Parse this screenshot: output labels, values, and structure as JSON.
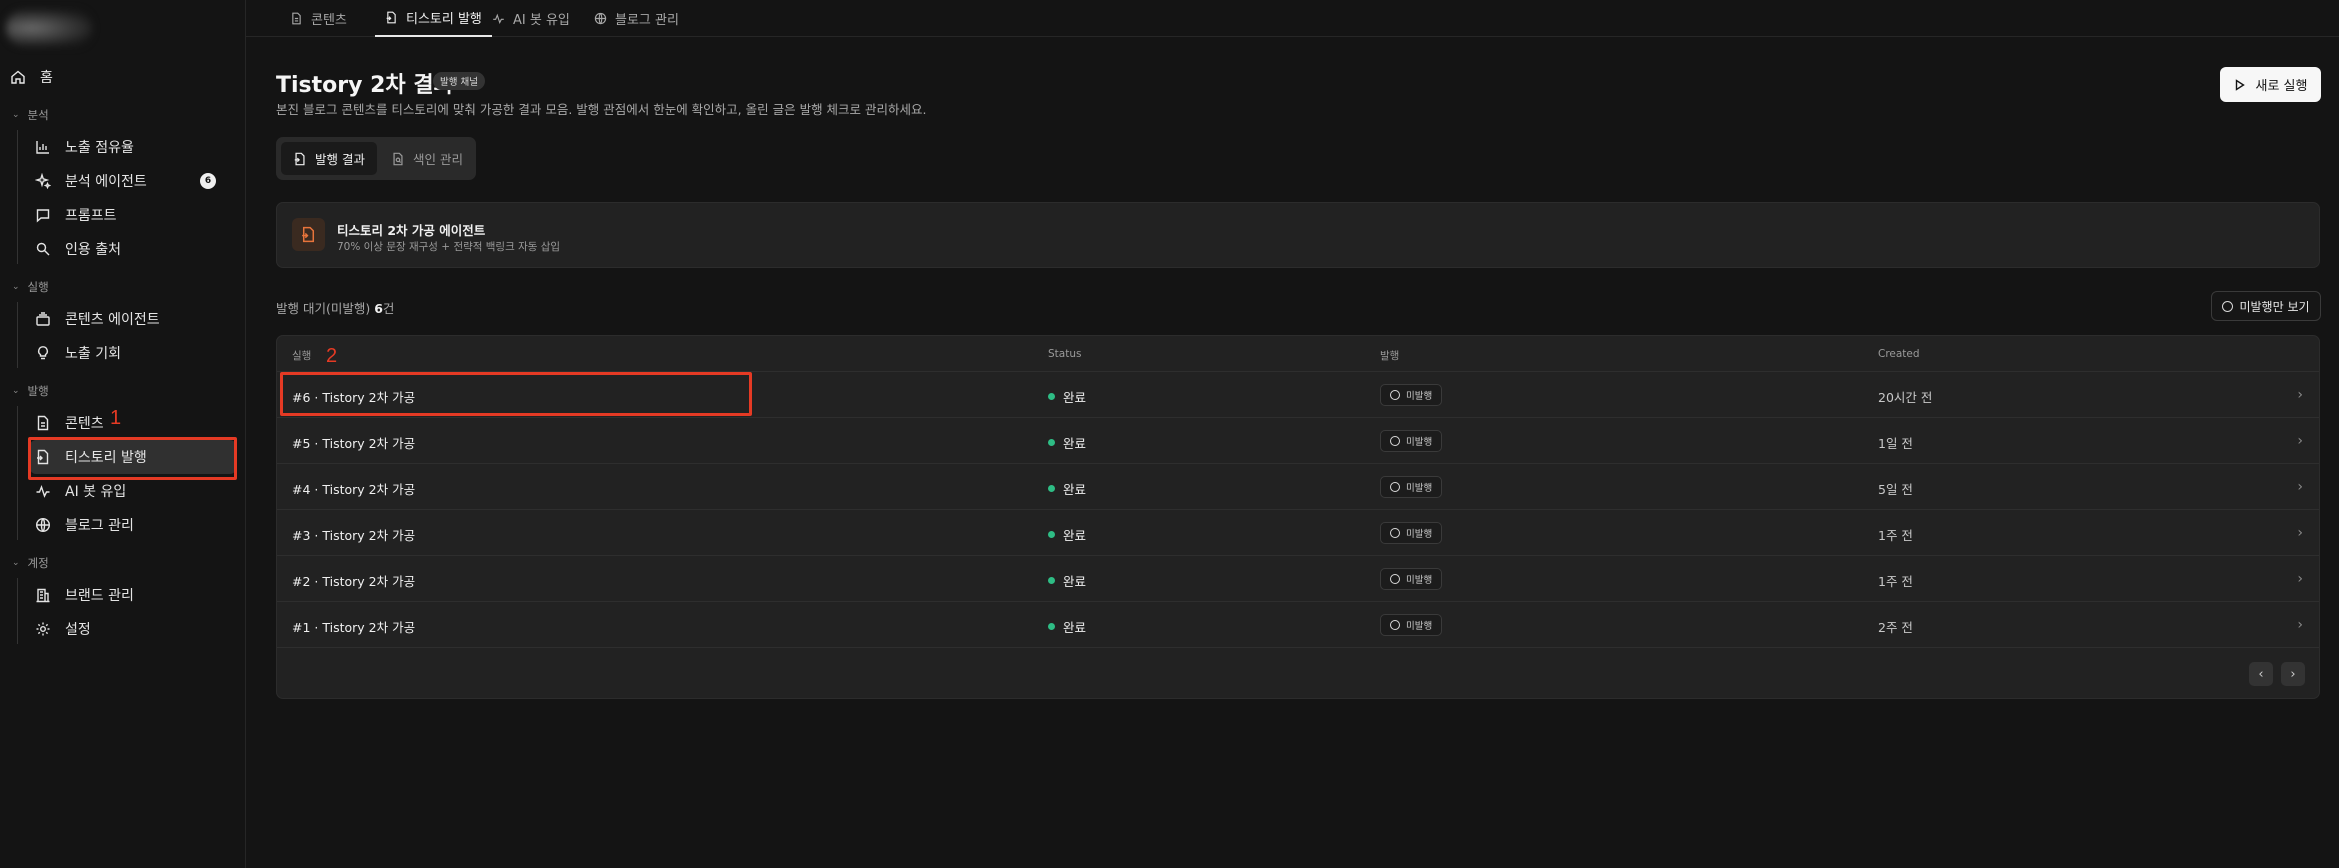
{
  "sidebar": {
    "home": "홈",
    "sections": [
      {
        "label": "분석",
        "items": [
          {
            "label": "노출 점유율",
            "icon": "bar-chart-icon"
          },
          {
            "label": "분석 에이전트",
            "icon": "sparkle-icon",
            "badge": "6"
          },
          {
            "label": "프롬프트",
            "icon": "message-icon"
          },
          {
            "label": "인용 출처",
            "icon": "quote-icon"
          }
        ]
      },
      {
        "label": "실행",
        "items": [
          {
            "label": "콘텐츠 에이전트",
            "icon": "layers-icon"
          },
          {
            "label": "노출 기회",
            "icon": "lightbulb-icon"
          }
        ]
      },
      {
        "label": "발행",
        "items": [
          {
            "label": "콘텐츠",
            "icon": "file-icon"
          },
          {
            "label": "티스토리 발행",
            "icon": "file-export-icon",
            "active": true
          },
          {
            "label": "AI 봇 유입",
            "icon": "activity-icon"
          },
          {
            "label": "블로그 관리",
            "icon": "globe-icon"
          }
        ]
      },
      {
        "label": "계정",
        "items": [
          {
            "label": "브랜드 관리",
            "icon": "building-icon"
          },
          {
            "label": "설정",
            "icon": "gear-icon"
          }
        ]
      }
    ]
  },
  "top_tabs": [
    {
      "label": "콘텐츠",
      "icon": "file-icon"
    },
    {
      "label": "티스토리 발행",
      "icon": "file-export-icon",
      "active": true
    },
    {
      "label": "AI 봇 유입",
      "icon": "activity-icon"
    },
    {
      "label": "블로그 관리",
      "icon": "globe-icon"
    }
  ],
  "header": {
    "title": "Tistory 2차 결과",
    "badge": "발행 채널",
    "description": "본진 블로그 콘텐츠를 티스토리에 맞춰 가공한 결과 모음. 발행 관점에서 한눈에 확인하고, 올린 글은 발행 체크로 관리하세요.",
    "run_button": "새로 실행"
  },
  "sub_tabs": [
    {
      "label": "발행 결과",
      "active": true
    },
    {
      "label": "색인 관리"
    }
  ],
  "agent": {
    "name": "티스토리 2차 가공 에이전트",
    "description": "70% 이상 문장 재구성 + 전략적 백링크 자동 삽입"
  },
  "pending": {
    "label": "발행 대기(미발행)",
    "count": "6",
    "unit": "건"
  },
  "filter_button": "미발행만 보기",
  "table": {
    "headers": {
      "run": "실행",
      "status": "Status",
      "publish": "발행",
      "created": "Created"
    },
    "rows": [
      {
        "run": "#6 · Tistory 2차 가공",
        "status": "완료",
        "publish": "미발행",
        "created": "20시간 전"
      },
      {
        "run": "#5 · Tistory 2차 가공",
        "status": "완료",
        "publish": "미발행",
        "created": "1일 전"
      },
      {
        "run": "#4 · Tistory 2차 가공",
        "status": "완료",
        "publish": "미발행",
        "created": "5일 전"
      },
      {
        "run": "#3 · Tistory 2차 가공",
        "status": "완료",
        "publish": "미발행",
        "created": "1주 전"
      },
      {
        "run": "#2 · Tistory 2차 가공",
        "status": "완료",
        "publish": "미발행",
        "created": "1주 전"
      },
      {
        "run": "#1 · Tistory 2차 가공",
        "status": "완료",
        "publish": "미발행",
        "created": "2주 전"
      }
    ]
  },
  "annotations": [
    "1",
    "2"
  ],
  "colors": {
    "accent_red": "#e53a24",
    "status_green": "#2ebd85",
    "agent_orange": "#e8743b"
  }
}
